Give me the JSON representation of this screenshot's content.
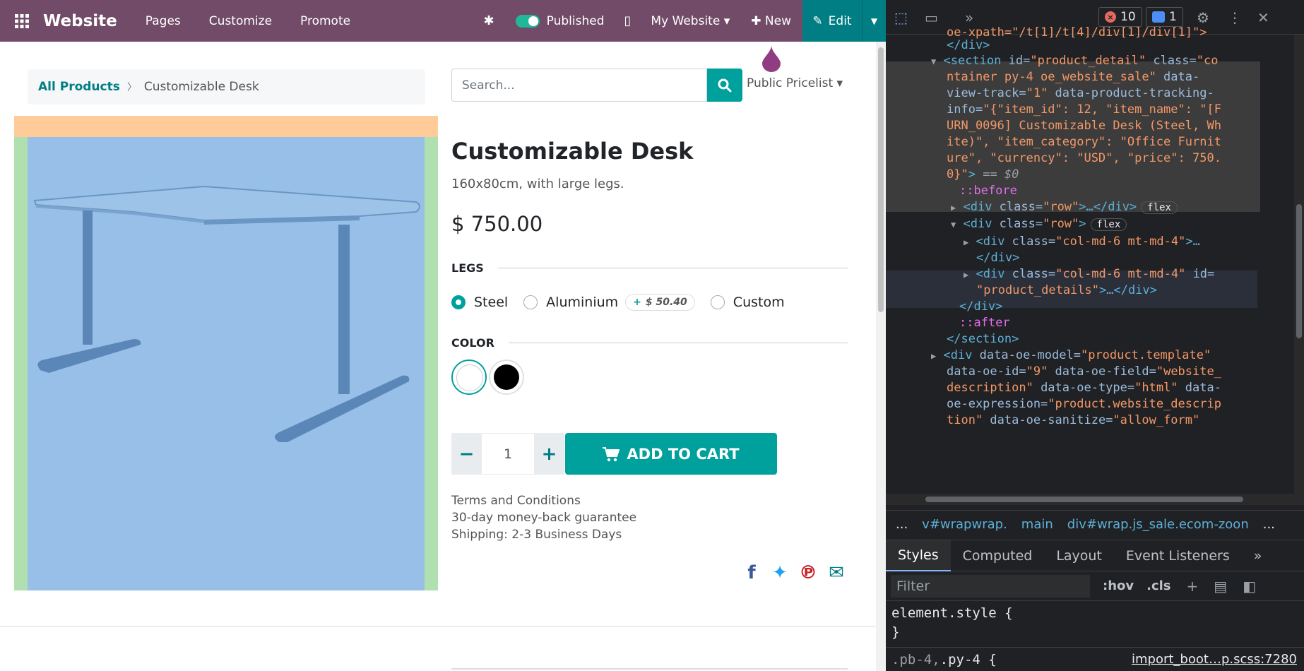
{
  "topbar": {
    "brand": "Website",
    "menus": [
      "Pages",
      "Customize",
      "Promote"
    ],
    "published_label": "Published",
    "my_website_label": "My Website ▾",
    "new_label": "New",
    "edit_label": "Edit"
  },
  "breadcrumb": {
    "parent": "All Products",
    "current": "Customizable Desk"
  },
  "search": {
    "placeholder": "Search...",
    "pricelist": "Public Pricelist ▾"
  },
  "product": {
    "title": "Customizable Desk",
    "description": "160x80cm, with large legs.",
    "price": "$ 750.00",
    "legs_label": "LEGS",
    "legs_options": [
      "Steel",
      "Aluminium",
      "Custom"
    ],
    "legs_selected": "Steel",
    "aluminium_extra": "$ 50.40",
    "color_label": "COLOR",
    "colors": [
      "#ffffff",
      "#000000"
    ],
    "quantity": "1",
    "add_to_cart": "ADD TO CART",
    "terms": [
      "Terms and Conditions",
      "30-day money-back guarantee",
      "Shipping: 2-3 Business Days"
    ]
  },
  "devtools": {
    "error_count": "10",
    "message_count": "1",
    "code_lines": {
      "l0": "oe-xpath=\"/t[1]/t[4]/div[1]/div[1]\">",
      "l1": "</div>",
      "l2a": "<section ",
      "l2b": "id=",
      "l2c": "\"product_detail\"",
      "l2d": " class=",
      "l2e": "\"co",
      "l3": "ntainer py-4 oe_website_sale\"",
      "l3b": " data-",
      "l4a": "view-track=",
      "l4b": "\"1\"",
      "l4c": " data-product-tracking-",
      "l5a": "info=",
      "l5b": "\"{\"item_id\": 12, \"item_name\": \"[F",
      "l6": "URN_0096] Customizable Desk (Steel, Wh",
      "l7": "ite)\", \"item_category\": \"Office Furnit",
      "l8": "ure\", \"currency\": \"USD\", \"price\": 750.",
      "l9a": "0}\"",
      "l9b": "> ",
      "l9c": "== $0",
      "l10": "::before",
      "l11a": "<div ",
      "l11b": "class=",
      "l11c": "\"row\"",
      "l11d": ">…</div>",
      "l12a": "<div ",
      "l12b": "class=",
      "l12c": "\"row\"",
      "l12d": ">",
      "l13a": "<div ",
      "l13b": "class=",
      "l13c": "\"col-md-6 mt-md-4\"",
      "l13d": ">…",
      "l14": "</div>",
      "l15a": "<div ",
      "l15b": "class=",
      "l15c": "\"col-md-6 mt-md-4\"",
      "l15d": " id=",
      "l16a": "\"product_details\"",
      "l16b": ">…</div>",
      "l17": "</div>",
      "l18": "::after",
      "l19": "</section>",
      "l20a": "<div ",
      "l20b": "data-oe-model=",
      "l20c": "\"product.template\"",
      "l21a": "data-oe-id=",
      "l21b": "\"9\"",
      "l21c": " data-oe-field=",
      "l21d": "\"website_",
      "l22a": "description\"",
      "l22b": " data-oe-type=",
      "l22c": "\"html\"",
      "l22d": " data-",
      "l23a": "oe-expression=",
      "l23b": "\"product.website_descrip",
      "l24a": "tion\"",
      "l24b": " data-oe-sanitize=",
      "l24c": "\"allow_form\""
    },
    "flex_pill": "flex",
    "breadcrumbs": [
      "...",
      "v#wrapwrap.",
      "main",
      "div#wrap.js_sale.ecom-zoon",
      "..."
    ],
    "tabs": [
      "Styles",
      "Computed",
      "Layout",
      "Event Listeners",
      "»"
    ],
    "filter_placeholder": "Filter",
    "hov": ":hov",
    "cls": ".cls",
    "element_style": "element.style {",
    "close_brace": "}",
    "rule_selector_a": ".pb-4,",
    "rule_selector_b": " .py-4 {",
    "rule_source": "import_boot…p.scss:7280"
  }
}
